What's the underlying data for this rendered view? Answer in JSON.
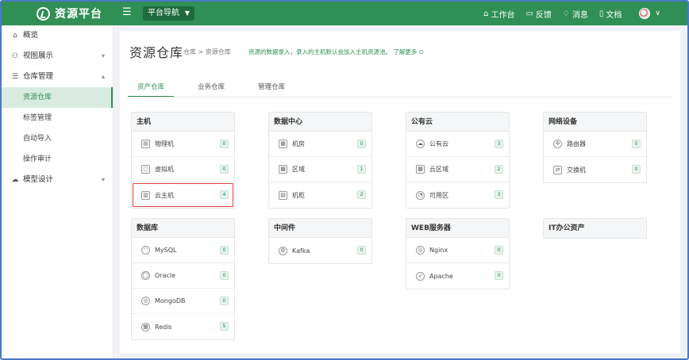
{
  "app": {
    "title": "资源平台"
  },
  "topbar": {
    "nav_select": "平台导航",
    "items": [
      {
        "icon": "home-icon",
        "glyph": "⌂",
        "label": "工作台"
      },
      {
        "icon": "feedback-icon",
        "glyph": "▭",
        "label": "反馈"
      },
      {
        "icon": "bell-icon",
        "glyph": "♢",
        "label": "消息"
      },
      {
        "icon": "doc-icon",
        "glyph": "▯",
        "label": "文档"
      }
    ]
  },
  "sidebar": {
    "items": [
      {
        "label": "概览",
        "icon": "home-icon",
        "glyph": "⌂"
      },
      {
        "label": "视图展示",
        "icon": "view-icon",
        "glyph": "⚇",
        "arrow": "▾"
      },
      {
        "label": "仓库管理",
        "icon": "list-icon",
        "glyph": "☰",
        "arrow": "▴"
      },
      {
        "label": "模型设计",
        "icon": "model-icon",
        "glyph": "☁",
        "arrow": "▾"
      }
    ],
    "sub_items": [
      {
        "label": "资源仓库",
        "active": true
      },
      {
        "label": "标签管理"
      },
      {
        "label": "自动导入"
      },
      {
        "label": "操作审计"
      }
    ]
  },
  "page": {
    "title": "资源仓库",
    "breadcrumb": "仓库 > 资源仓库",
    "tip": "资源的数据录入，录入的主机默认会加入主机资源池。 了解更多 ⊙"
  },
  "tabs": [
    {
      "label": "资产仓库",
      "active": true
    },
    {
      "label": "业务仓库"
    },
    {
      "label": "管理仓库"
    }
  ],
  "cards": [
    {
      "title": "主机",
      "rows": [
        {
          "label": "物理机",
          "count": "0",
          "icon": "server-icon",
          "glyph": "▤"
        },
        {
          "label": "虚拟机",
          "count": "0",
          "icon": "vm-icon",
          "glyph": "▢"
        },
        {
          "label": "云主机",
          "count": "4",
          "icon": "cloud-host-icon",
          "glyph": "▥",
          "highlight": true
        }
      ]
    },
    {
      "title": "数据中心",
      "rows": [
        {
          "label": "机房",
          "count": "0",
          "icon": "building-icon",
          "glyph": "▦"
        },
        {
          "label": "区域",
          "count": "1",
          "icon": "region-icon",
          "glyph": "▩"
        },
        {
          "label": "机柜",
          "count": "2",
          "icon": "rack-icon",
          "glyph": "▤"
        }
      ]
    },
    {
      "title": "公有云",
      "rows": [
        {
          "label": "公有云",
          "count": "3",
          "icon": "cloud-icon",
          "glyph": "☁"
        },
        {
          "label": "云区域",
          "count": "2",
          "icon": "cloud-region-icon",
          "glyph": "▩"
        },
        {
          "label": "可用区",
          "count": "3",
          "icon": "zone-icon",
          "glyph": "◔"
        }
      ]
    },
    {
      "title": "网络设备",
      "rows": [
        {
          "label": "路由器",
          "count": "0",
          "icon": "router-icon",
          "glyph": "✣"
        },
        {
          "label": "交换机",
          "count": "0",
          "icon": "switch-icon",
          "glyph": "⇄"
        }
      ]
    },
    {
      "title": "数据库",
      "rows": [
        {
          "label": "MySQL",
          "count": "0",
          "icon": "mysql-icon",
          "glyph": "◠"
        },
        {
          "label": "Oracle",
          "count": "0",
          "icon": "oracle-icon",
          "glyph": "◯"
        },
        {
          "label": "MongoDB",
          "count": "0",
          "icon": "mongodb-icon",
          "glyph": "◎"
        },
        {
          "label": "Redis",
          "count": "5",
          "icon": "redis-icon",
          "glyph": "▦"
        }
      ]
    },
    {
      "title": "中间件",
      "rows": [
        {
          "label": "Kafka",
          "count": "0",
          "icon": "kafka-icon",
          "glyph": "⚙"
        }
      ]
    },
    {
      "title": "WEB服务器",
      "rows": [
        {
          "label": "Nginx",
          "count": "0",
          "icon": "nginx-icon",
          "glyph": "◎"
        },
        {
          "label": "Apache",
          "count": "0",
          "icon": "apache-icon",
          "glyph": "➶"
        }
      ]
    },
    {
      "title": "IT办公资产",
      "rows": []
    }
  ]
}
